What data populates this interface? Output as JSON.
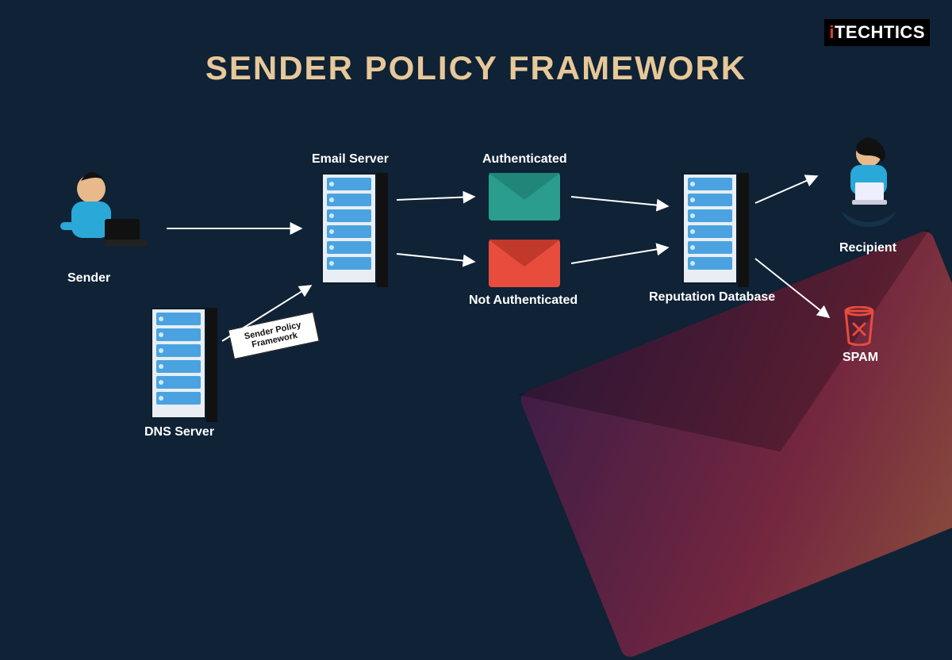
{
  "brand": {
    "pre": "i",
    "mid": "TECH",
    "post": "TICS"
  },
  "title": "SENDER POLICY FRAMEWORK",
  "nodes": {
    "sender": "Sender",
    "dns": "DNS Server",
    "email_server": "Email Server",
    "authenticated": "Authenticated",
    "not_authenticated": "Not Authenticated",
    "reputation": "Reputation Database",
    "recipient": "Recipient",
    "spam": "SPAM"
  },
  "tag": {
    "line1": "Sender Policy",
    "line2": "Framework"
  },
  "colors": {
    "bg": "#0f2236",
    "title": "#e7c898",
    "auth": "#2a9d8f",
    "noauth": "#e74c3c",
    "spam": "#e74c3c",
    "accent": "#4aa3e0"
  }
}
